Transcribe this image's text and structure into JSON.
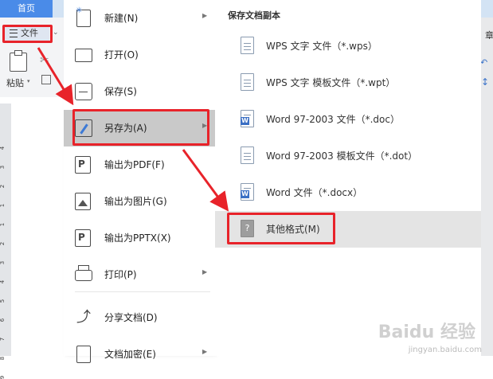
{
  "app": {
    "home_tab": "首页",
    "file_menu": "文件",
    "paste_label": "粘贴",
    "ruler_marks": [
      "4",
      "3",
      "2",
      "1",
      "1",
      "2",
      "3",
      "4",
      "5",
      "6",
      "7",
      "8",
      "9"
    ],
    "right_edge_char": "章"
  },
  "file_menu": {
    "items": [
      {
        "label": "新建(N)",
        "icon": "new-document-icon",
        "has_submenu": true
      },
      {
        "label": "打开(O)",
        "icon": "folder-icon",
        "has_submenu": false
      },
      {
        "label": "保存(S)",
        "icon": "save-icon",
        "has_submenu": false
      },
      {
        "label": "另存为(A)",
        "icon": "save-as-icon",
        "has_submenu": true,
        "highlighted": true
      },
      {
        "label": "输出为PDF(F)",
        "icon": "pdf-icon",
        "has_submenu": false
      },
      {
        "label": "输出为图片(G)",
        "icon": "image-icon",
        "has_submenu": false
      },
      {
        "label": "输出为PPTX(X)",
        "icon": "pptx-icon",
        "has_submenu": false
      },
      {
        "label": "打印(P)",
        "icon": "printer-icon",
        "has_submenu": true
      },
      {
        "label": "分享文档(D)",
        "icon": "share-icon",
        "has_submenu": false
      },
      {
        "label": "文档加密(E)",
        "icon": "encrypt-icon",
        "has_submenu": true
      }
    ]
  },
  "save_as_submenu": {
    "title": "保存文档副本",
    "items": [
      {
        "label": "WPS 文字 文件（*.wps）",
        "icon": "wps-file-icon"
      },
      {
        "label": "WPS 文字 模板文件（*.wpt）",
        "icon": "wps-template-icon"
      },
      {
        "label": "Word 97-2003 文件（*.doc）",
        "icon": "word-doc-icon"
      },
      {
        "label": "Word 97-2003 模板文件（*.dot）",
        "icon": "word-template-icon"
      },
      {
        "label": "Word 文件（*.docx）",
        "icon": "word-docx-icon"
      },
      {
        "label": "其他格式(M)",
        "icon": "other-format-icon",
        "highlighted": true
      }
    ]
  },
  "watermark": {
    "text": "Baidu 经验",
    "sub": "jingyan.baidu.com"
  },
  "colors": {
    "annotation_red": "#e8232a",
    "accent_blue": "#4a8be8",
    "menu_highlight": "#c9c9c9"
  }
}
